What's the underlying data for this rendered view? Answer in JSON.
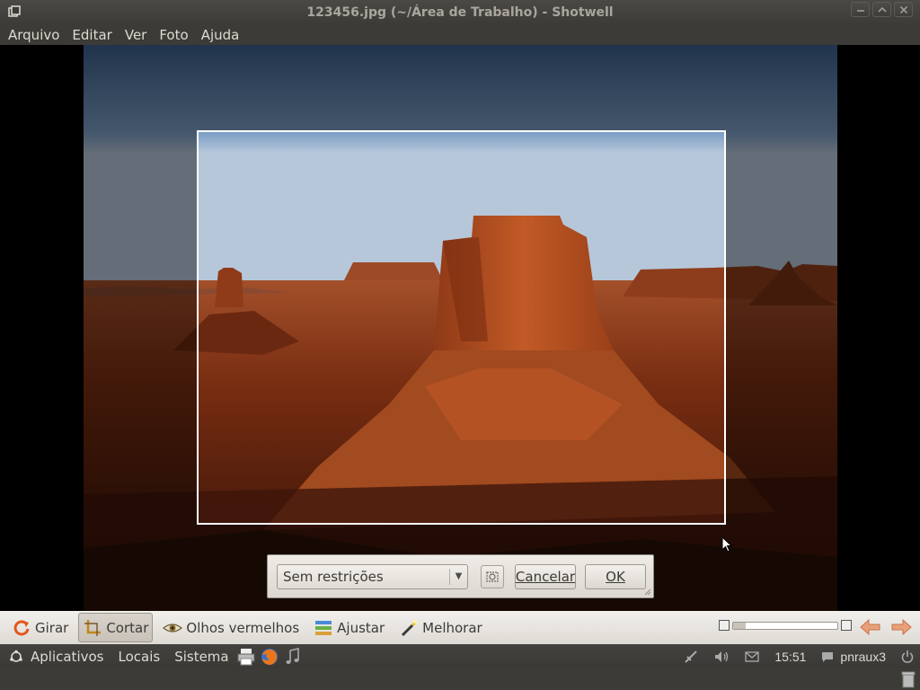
{
  "window": {
    "title": "123456.jpg (~/Área de Trabalho) - Shotwell",
    "icons": {
      "app": "shotwell-icon",
      "minimize": "minimize-icon",
      "maximize": "maximize-icon",
      "close": "close-icon"
    }
  },
  "menubar": {
    "items": [
      "Arquivo",
      "Editar",
      "Ver",
      "Foto",
      "Ajuda"
    ]
  },
  "crop_dialog": {
    "constraint_value": "Sem restrições",
    "pivot_icon": "pivot-reticle-icon",
    "cancel_label": "Cancelar",
    "ok_label": "OK"
  },
  "toolbar": {
    "tools": [
      {
        "label": "Girar",
        "icon": "rotate-icon"
      },
      {
        "label": "Cortar",
        "icon": "crop-icon",
        "active": true
      },
      {
        "label": "Olhos vermelhos",
        "icon": "red-eye-icon"
      },
      {
        "label": "Ajustar",
        "icon": "adjust-icon"
      },
      {
        "label": "Melhorar",
        "icon": "enhance-icon"
      }
    ],
    "zoom_level": 0.12
  },
  "panel": {
    "menus": [
      "Aplicativos",
      "Locais",
      "Sistema"
    ],
    "launchers": [
      "printer-icon",
      "firefox-icon",
      "music-icon"
    ],
    "clock": "15:51",
    "user": "pnraux3"
  },
  "colors": {
    "accent": "#f07746",
    "panel": "#3c3b37",
    "toolbar": "#e9e6e1"
  }
}
